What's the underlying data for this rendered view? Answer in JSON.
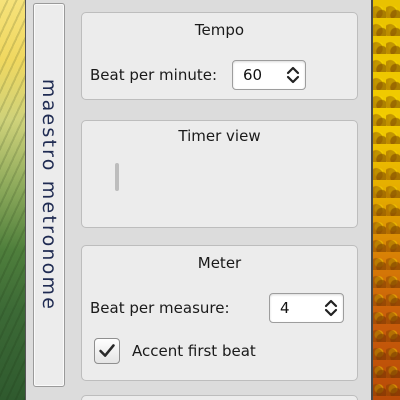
{
  "app": {
    "vertical_title": "maestro metronome"
  },
  "tempo": {
    "title": "Tempo",
    "bpm_label": "Beat per minute:",
    "bpm_value": "60"
  },
  "timer": {
    "title": "Timer view"
  },
  "meter": {
    "title": "Meter",
    "measure_label": "Beat per measure:",
    "measure_value": "4",
    "accent_label": "Accent first beat",
    "accent_checked": true
  },
  "icons": {
    "spin": "up-down-chevron-icon",
    "check": "checkmark-icon"
  }
}
